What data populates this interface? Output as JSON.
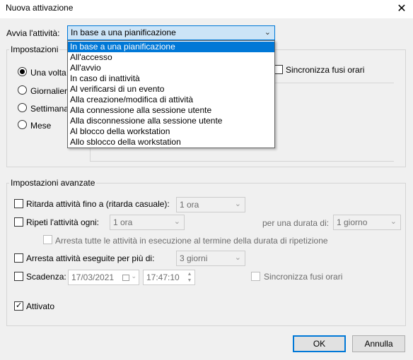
{
  "window": {
    "title": "Nuova attivazione"
  },
  "trigger": {
    "label": "Avvia l'attività:",
    "selected": "In base a una pianificazione",
    "options": [
      "In base a una pianificazione",
      "All'accesso",
      "All'avvio",
      "In caso di inattività",
      "Al verificarsi di un evento",
      "Alla creazione/modifica di attività",
      "Alla connessione alla sessione utente",
      "Alla disconnessione alla sessione utente",
      "Al blocco della workstation",
      "Allo sblocco della workstation"
    ]
  },
  "settings": {
    "legend": "Impostazioni",
    "radios": [
      "Una volta",
      "Giornaliera",
      "Settimana",
      "Mese"
    ],
    "sync_label": "Sincronizza fusi orari"
  },
  "advanced": {
    "legend": "Impostazioni avanzate",
    "delay_label": "Ritarda attività fino a (ritarda casuale):",
    "delay_value": "1 ora",
    "repeat_label": "Ripeti l'attività ogni:",
    "repeat_value": "1 ora",
    "duration_label": "per una durata di:",
    "duration_value": "1 giorno",
    "stop_all_label": "Arresta tutte le attività in esecuzione al termine della durata di ripetizione",
    "stop_long_label": "Arresta attività eseguite per più di:",
    "stop_long_value": "3 giorni",
    "expire_label": "Scadenza:",
    "expire_date": "17/03/2021",
    "expire_time": "17:47:10",
    "expire_sync_label": "Sincronizza fusi orari",
    "enabled_label": "Attivato"
  },
  "buttons": {
    "ok": "OK",
    "cancel": "Annulla"
  }
}
